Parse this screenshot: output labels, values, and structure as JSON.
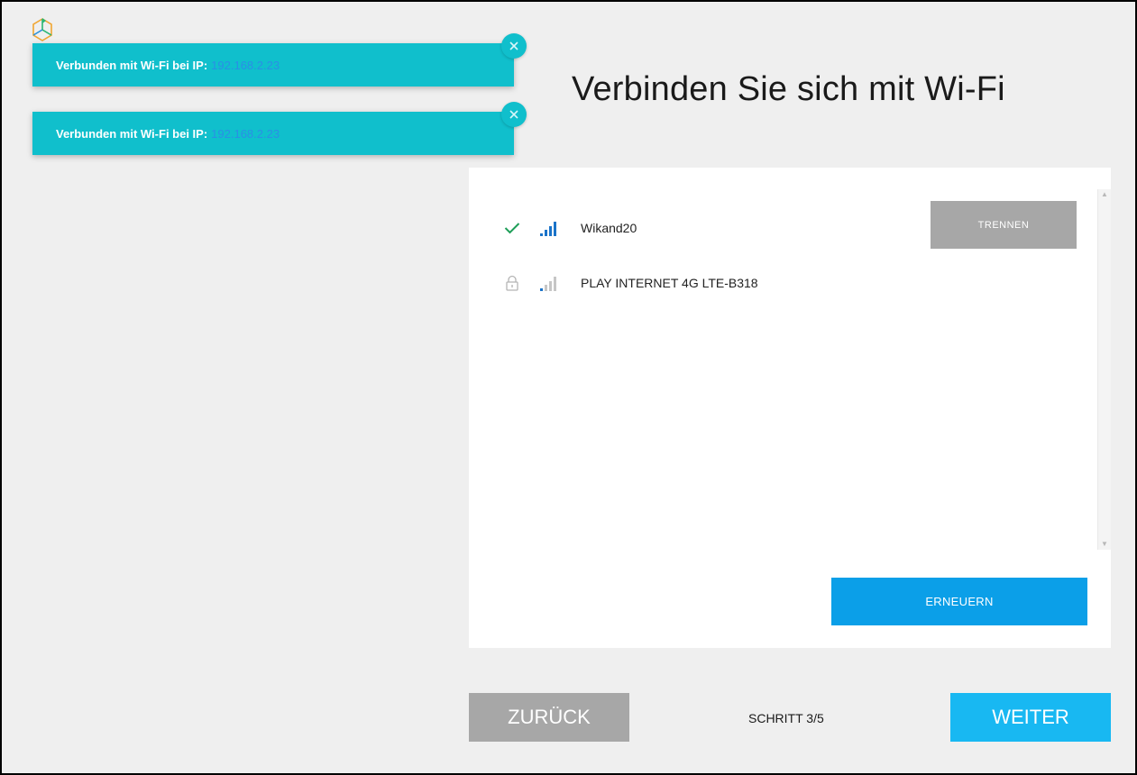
{
  "toasts": [
    {
      "message": "Verbunden mit Wi-Fi bei IP:",
      "ip": "192.168.2.23",
      "close_icon": "close-icon"
    },
    {
      "message": "Verbunden mit Wi-Fi bei IP:",
      "ip": "192.168.2.23",
      "close_icon": "close-icon"
    }
  ],
  "page": {
    "title": "Verbinden Sie sich mit Wi-Fi"
  },
  "networks": [
    {
      "name": "Wikand20",
      "status_icon": "check-icon",
      "signal_icon": "signal-full-icon",
      "connected": true
    },
    {
      "name": "PLAY INTERNET 4G LTE-B318",
      "status_icon": "lock-icon",
      "signal_icon": "signal-weak-icon",
      "connected": false
    }
  ],
  "panel": {
    "disconnect_label": "TRENNEN",
    "refresh_label": "ERNEUERN"
  },
  "footer": {
    "back_label": "ZURÜCK",
    "step_text": "SCHRITT 3/5",
    "next_label": "WEITER"
  },
  "colors": {
    "toast_bg": "#10bfcc",
    "ip_text": "#2b8fe6",
    "refresh_bg": "#0b9fe8",
    "next_bg": "#18b8f2",
    "disabled_bg": "#a7a7a7",
    "check": "#1e9e58",
    "signal": "#1a73c9"
  }
}
